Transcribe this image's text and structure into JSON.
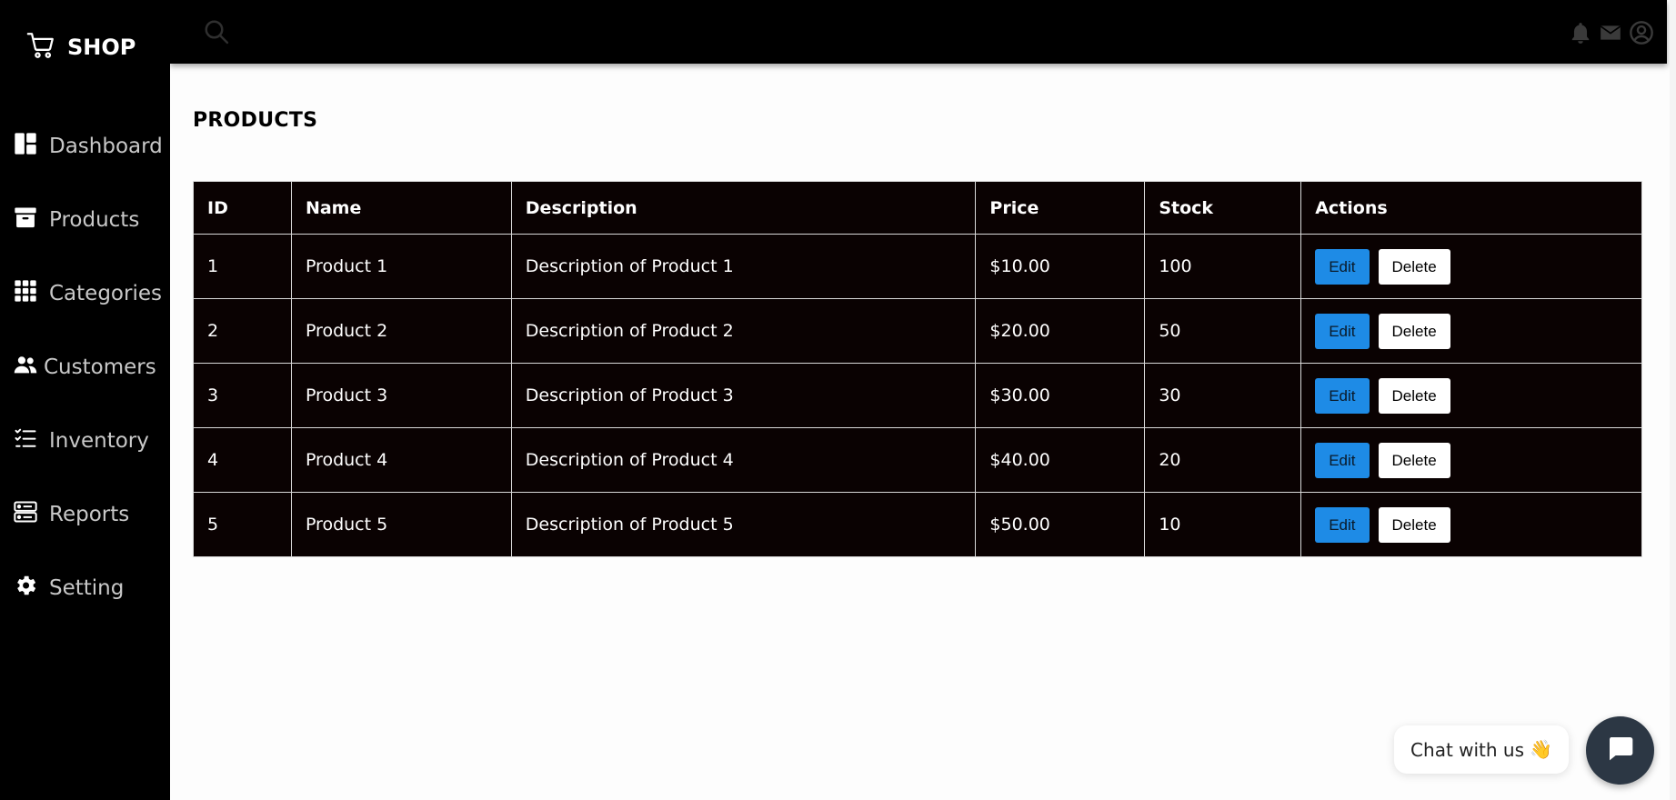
{
  "brand": {
    "title": "SHOP",
    "icon": "cart-icon"
  },
  "sidebar": {
    "items": [
      {
        "label": "Dashboard",
        "icon": "dashboard-icon"
      },
      {
        "label": "Products",
        "icon": "archive-box-icon"
      },
      {
        "label": "Categories",
        "icon": "grid-icon"
      },
      {
        "label": "Customers",
        "icon": "people-icon"
      },
      {
        "label": "Inventory",
        "icon": "checklist-icon"
      },
      {
        "label": "Reports",
        "icon": "server-icon"
      },
      {
        "label": "Setting",
        "icon": "gear-icon"
      }
    ]
  },
  "topbar": {
    "icons": [
      "search-icon",
      "bell-icon",
      "mail-icon",
      "user-circle-icon"
    ]
  },
  "main": {
    "title": "PRODUCTS",
    "table": {
      "columns": [
        "ID",
        "Name",
        "Description",
        "Price",
        "Stock",
        "Actions"
      ],
      "rows": [
        {
          "id": "1",
          "name": "Product 1",
          "description": "Description of Product 1",
          "price": "$10.00",
          "stock": "100"
        },
        {
          "id": "2",
          "name": "Product 2",
          "description": "Description of Product 2",
          "price": "$20.00",
          "stock": "50"
        },
        {
          "id": "3",
          "name": "Product 3",
          "description": "Description of Product 3",
          "price": "$30.00",
          "stock": "30"
        },
        {
          "id": "4",
          "name": "Product 4",
          "description": "Description of Product 4",
          "price": "$40.00",
          "stock": "20"
        },
        {
          "id": "5",
          "name": "Product 5",
          "description": "Description of Product 5",
          "price": "$50.00",
          "stock": "10"
        }
      ],
      "edit_label": "Edit",
      "delete_label": "Delete"
    }
  },
  "chat": {
    "label": "Chat with us",
    "emoji": "👋"
  },
  "colors": {
    "sidebar_bg": "#000000",
    "table_bg": "#0a0202",
    "edit_button": "#1e8be6",
    "chat_bubble": "#2c3744"
  }
}
